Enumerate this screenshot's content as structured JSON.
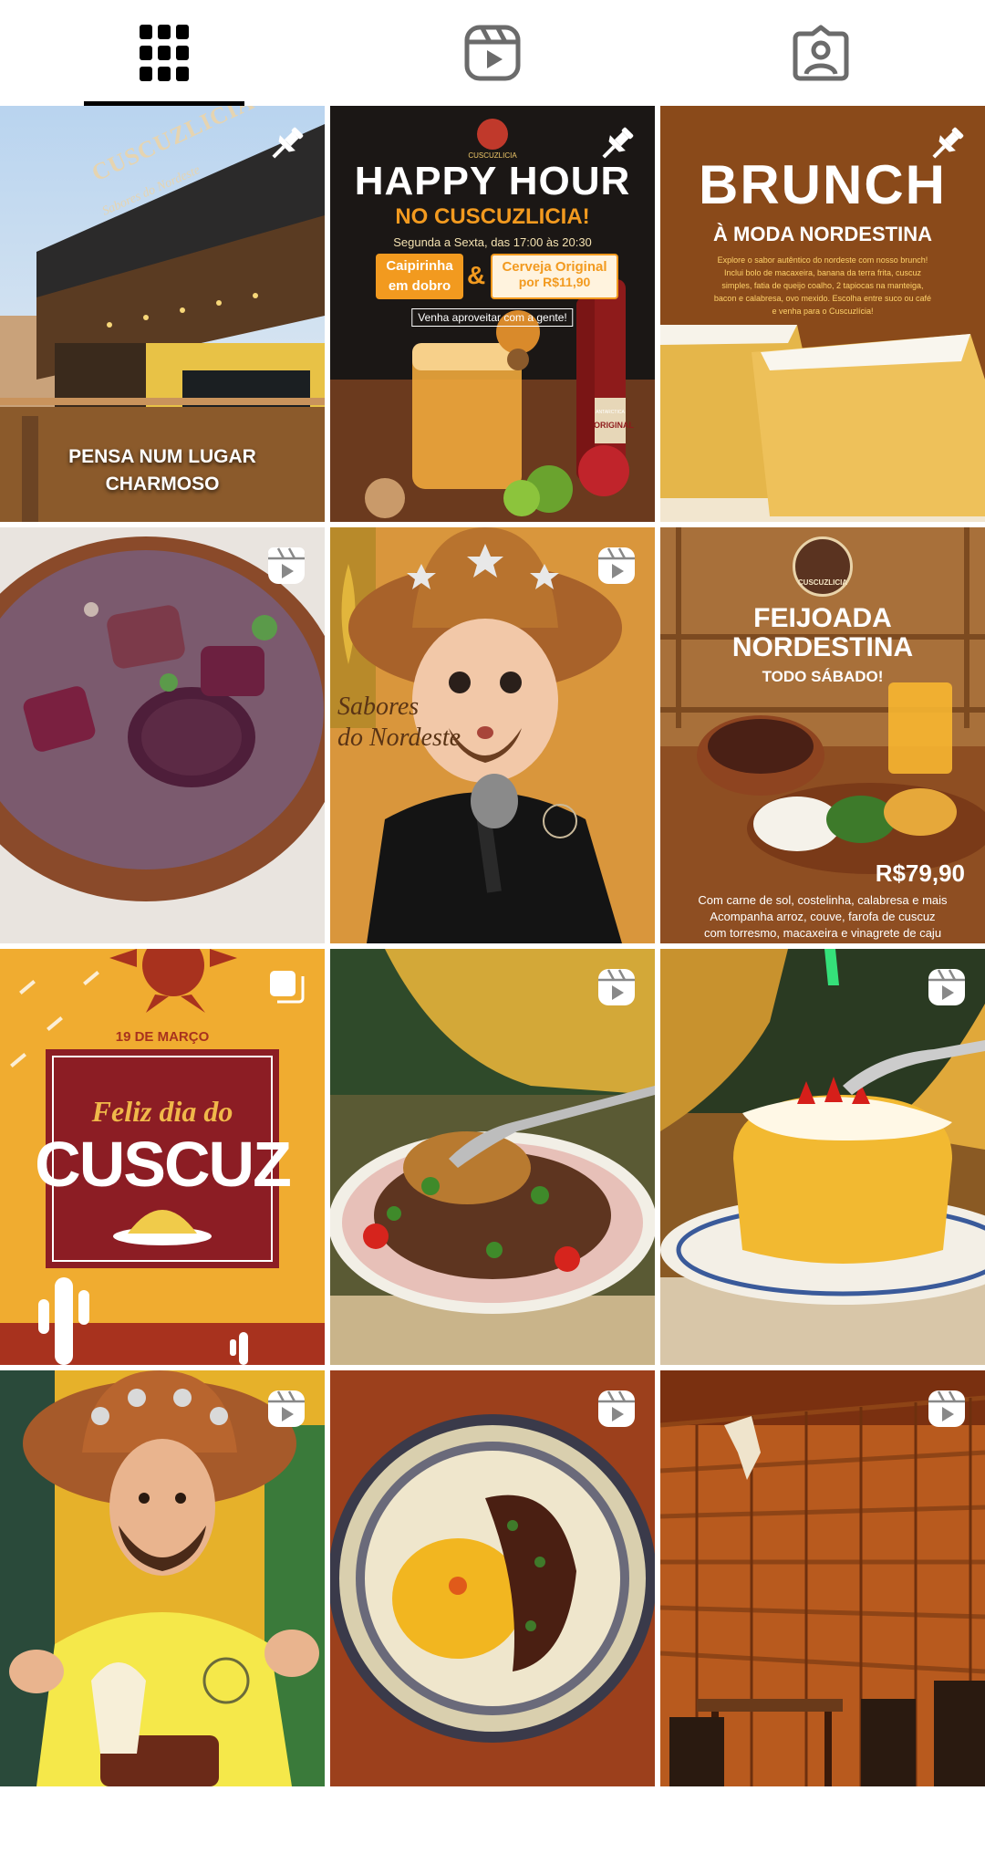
{
  "tabs": [
    {
      "name": "grid-icon",
      "active": true
    },
    {
      "name": "reels-icon",
      "active": false
    },
    {
      "name": "tagged-icon",
      "active": false
    }
  ],
  "posts": {
    "p1": {
      "overlay": "PENSA NUM LUGAR\nCHARMOSO",
      "sign": "CUSCUZLICIA",
      "sign_sub": "Sabores do Nordeste"
    },
    "p2": {
      "logo": "CUSCUZLICIA",
      "title1": "HAPPY HOUR",
      "title2": "NO CUSCUZLICIA!",
      "days": "Segunda a Sexta, das 17:00 às 20:30",
      "left_box": "Caipirinha\nem dobro",
      "amp": "&",
      "right_box_1": "Cerveja Original",
      "right_box_2": "por R$11,90",
      "cta": "Venha aproveitar com a gente!",
      "bottle_label": "ORIGINAL",
      "bottle_brand": "ANTARCTICA"
    },
    "p3": {
      "title1": "BRUNCH",
      "title2": "À MODA NORDESTINA",
      "body": "Explore o sabor autêntico do nordeste com nosso brunch!\nInclui bolo de macaxeira, banana da terra frita, cuscuz\nsimples, fatia de queijo coalho, 2 tapiocas na manteiga,\nbacon e calabresa, ovo mexido. Escolha entre suco ou café\ne venha para o Cuscuzlícia!"
    },
    "p6": {
      "logo": "CUSCUZLICIA",
      "title1": "FEIJOADA",
      "title2": "NORDESTINA",
      "sub": "TODO SÁBADO!",
      "price": "R$79,90",
      "body": "Com carne de sol, costelinha, calabresa e mais\nAcompanha arroz, couve, farofa de cuscuz\ncom torresmo, macaxeira e vinagrete de caju"
    },
    "p7": {
      "date": "19 DE MARÇO",
      "line1": "Feliz dia do",
      "line2": "CUSCUZ"
    },
    "p5": {
      "wall": "Sabores\ndo Nordeste"
    }
  },
  "colors": {
    "pin": "#ffffff",
    "accent_orange": "#f29a1f",
    "maroon": "#8c1d24"
  }
}
